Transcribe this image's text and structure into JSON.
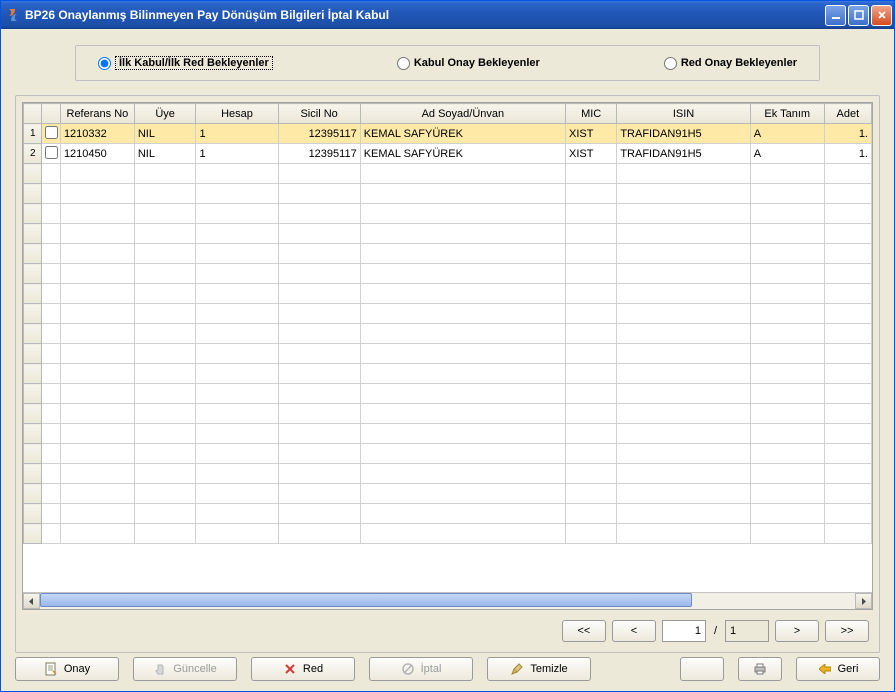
{
  "window": {
    "title": "BP26 Onaylanmış Bilinmeyen Pay Dönüşüm Bilgileri İptal Kabul"
  },
  "filters": {
    "opt1": "İlk Kabul/İlk Red Bekleyenler",
    "opt2": "Kabul Onay Bekleyenler",
    "opt3": "Red Onay Bekleyenler",
    "selected": 1
  },
  "grid": {
    "columns": {
      "referans": "Referans No",
      "uye": "Üye",
      "hesap": "Hesap",
      "sicil": "Sicil No",
      "adsoyad": "Ad Soyad/Ünvan",
      "mic": "MIC",
      "isin": "ISIN",
      "ektanim": "Ek Tanım",
      "adet": "Adet"
    },
    "rows": [
      {
        "checked": false,
        "ref": "1210332",
        "uye": "NIL",
        "hesap": "1",
        "sicil": "12395117",
        "ad": "KEMAL SAFYÜREK",
        "mic": "XIST",
        "isin": "TRAFIDAN91H5",
        "ek": "A",
        "adet": "1."
      },
      {
        "checked": false,
        "ref": "1210450",
        "uye": "NIL",
        "hesap": "1",
        "sicil": "12395117",
        "ad": "KEMAL SAFYÜREK",
        "mic": "XIST",
        "isin": "TRAFIDAN91H5",
        "ek": "A",
        "adet": "1."
      }
    ],
    "empty_rows": 19
  },
  "pager": {
    "first": "<<",
    "prev": "<",
    "page_value": "1",
    "page_total": "1",
    "next": ">",
    "last": ">>"
  },
  "footer": {
    "onay": "Onay",
    "guncelle": "Güncelle",
    "red": "Red",
    "iptal": "İptal",
    "temizle": "Temizle",
    "geri": "Geri"
  }
}
